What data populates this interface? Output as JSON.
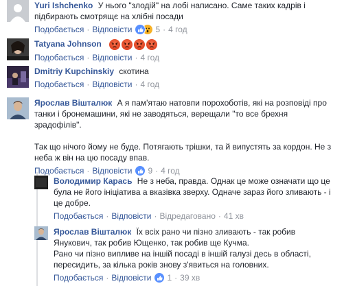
{
  "common": {
    "like": "Подобається",
    "reply": "Відповісти",
    "sep": "·"
  },
  "comments": [
    {
      "author": "Yuri Ishchenko",
      "text": "У нього \"злодій\" на лобі написано. Саме таких кадрів і підбирають смотрящє на хлібні посади",
      "reactions": "5",
      "time": "4 год"
    },
    {
      "author": "Tatyana Johnson",
      "emoji_count": 4,
      "emoji_icon": "angry-face-icon",
      "time": "4 год"
    },
    {
      "author": "Dmitriy Kupchinskiy",
      "text": "скотина",
      "time": "4 год"
    },
    {
      "author": "Ярослав Вішталюк",
      "text": "А я пам'ятаю натовпи порохоботів, які на розповіді про танки і бронемашини, які не заводяться, верещали \"то все брехня зрадофілів\".",
      "text2": "Так що нічого йому не буде. Потягають трішки, та й випустять за кордон. Не з неба ж він на цю посаду впав.",
      "reactions": "9",
      "time": "4 год"
    }
  ],
  "replies": [
    {
      "author": "Володимир Карась",
      "text": "Не з неба, правда. Однак це може означати що це була не його ініціатива а вказівка зверху. Одначе зараз його зливають - і це добре.",
      "edited": "Відредаговано",
      "time": "41 хв"
    },
    {
      "author": "Ярослав Вішталюк",
      "text": "Їх всіх рано чи пізно зливають - так робив Янукович, так робив Ющенко, так робив ще Кучма.",
      "text2": "Рано чи пізно випливе на іншій посаді в іншій галузі десь в області, пересидить, за кілька років знову з'явиться на головних.",
      "reactions": "1",
      "time": "39 хв"
    }
  ],
  "colors": {
    "link": "#365899",
    "muted": "#90949c",
    "text": "#1d2129",
    "like_blue": "#5890ff",
    "angry": "#e8603a"
  }
}
